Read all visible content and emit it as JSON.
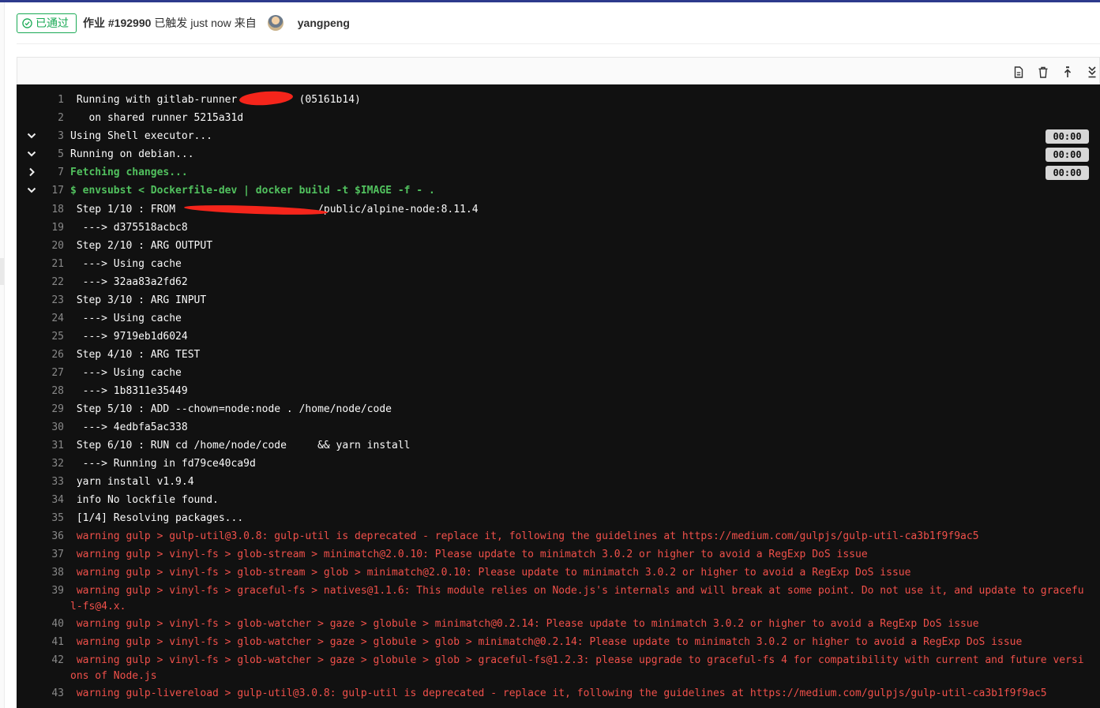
{
  "header": {
    "status_label": "已通过",
    "job_id": "作业 #192990",
    "triggered": "已触发",
    "time": "just now",
    "from": "来自",
    "user": "yangpeng"
  },
  "toolbar": {
    "icons": [
      "raw-log-icon",
      "erase-log-icon",
      "scroll-to-top-icon",
      "scroll-to-bottom-icon"
    ]
  },
  "log": {
    "lines": [
      {
        "num": "1",
        "text": " Running with gitlab-runner          (05161b14)",
        "color": "w"
      },
      {
        "num": "2",
        "text": "   on shared runner 5215a31d",
        "color": "w"
      },
      {
        "num": "3",
        "text": "Using Shell executor...",
        "color": "w",
        "toggle": "down",
        "duration": "00:00"
      },
      {
        "num": "5",
        "text": "Running on debian...",
        "color": "w",
        "toggle": "down",
        "duration": "00:00"
      },
      {
        "num": "7",
        "text": "Fetching changes...",
        "color": "g",
        "toggle": "right",
        "duration": "00:00"
      },
      {
        "num": "17",
        "text": "$ envsubst < Dockerfile-dev | docker build -t $IMAGE -f - .",
        "color": "g",
        "toggle": "down"
      },
      {
        "num": "18",
        "text": " Step 1/10 : FROM                       /public/alpine-node:8.11.4",
        "color": "w"
      },
      {
        "num": "19",
        "text": "  ---> d375518acbc8",
        "color": "w"
      },
      {
        "num": "20",
        "text": " Step 2/10 : ARG OUTPUT",
        "color": "w"
      },
      {
        "num": "21",
        "text": "  ---> Using cache",
        "color": "w"
      },
      {
        "num": "22",
        "text": "  ---> 32aa83a2fd62",
        "color": "w"
      },
      {
        "num": "23",
        "text": " Step 3/10 : ARG INPUT",
        "color": "w"
      },
      {
        "num": "24",
        "text": "  ---> Using cache",
        "color": "w"
      },
      {
        "num": "25",
        "text": "  ---> 9719eb1d6024",
        "color": "w"
      },
      {
        "num": "26",
        "text": " Step 4/10 : ARG TEST",
        "color": "w"
      },
      {
        "num": "27",
        "text": "  ---> Using cache",
        "color": "w"
      },
      {
        "num": "28",
        "text": "  ---> 1b8311e35449",
        "color": "w"
      },
      {
        "num": "29",
        "text": " Step 5/10 : ADD --chown=node:node . /home/node/code",
        "color": "w"
      },
      {
        "num": "30",
        "text": "  ---> 4edbfa5ac338",
        "color": "w"
      },
      {
        "num": "31",
        "text": " Step 6/10 : RUN cd /home/node/code     && yarn install",
        "color": "w"
      },
      {
        "num": "32",
        "text": "  ---> Running in fd79ce40ca9d",
        "color": "w"
      },
      {
        "num": "33",
        "text": " yarn install v1.9.4",
        "color": "w"
      },
      {
        "num": "34",
        "text": " info No lockfile found.",
        "color": "w"
      },
      {
        "num": "35",
        "text": " [1/4] Resolving packages...",
        "color": "w"
      },
      {
        "num": "36",
        "text": " warning gulp > gulp-util@3.0.8: gulp-util is deprecated - replace it, following the guidelines at https://medium.com/gulpjs/gulp-util-ca3b1f9f9ac5",
        "color": "r"
      },
      {
        "num": "37",
        "text": " warning gulp > vinyl-fs > glob-stream > minimatch@2.0.10: Please update to minimatch 3.0.2 or higher to avoid a RegExp DoS issue",
        "color": "r"
      },
      {
        "num": "38",
        "text": " warning gulp > vinyl-fs > glob-stream > glob > minimatch@2.0.10: Please update to minimatch 3.0.2 or higher to avoid a RegExp DoS issue",
        "color": "r"
      },
      {
        "num": "39",
        "text": " warning gulp > vinyl-fs > graceful-fs > natives@1.1.6: This module relies on Node.js's internals and will break at some point. Do not use it, and update to graceful-fs@4.x.",
        "color": "r"
      },
      {
        "num": "40",
        "text": " warning gulp > vinyl-fs > glob-watcher > gaze > globule > minimatch@0.2.14: Please update to minimatch 3.0.2 or higher to avoid a RegExp DoS issue",
        "color": "r"
      },
      {
        "num": "41",
        "text": " warning gulp > vinyl-fs > glob-watcher > gaze > globule > glob > minimatch@0.2.14: Please update to minimatch 3.0.2 or higher to avoid a RegExp DoS issue",
        "color": "r"
      },
      {
        "num": "42",
        "text": " warning gulp > vinyl-fs > glob-watcher > gaze > globule > glob > graceful-fs@1.2.3: please upgrade to graceful-fs 4 for compatibility with current and future versions of Node.js",
        "color": "r"
      },
      {
        "num": "43",
        "text": " warning gulp-livereload > gulp-util@3.0.8: gulp-util is deprecated - replace it, following the guidelines at https://medium.com/gulpjs/gulp-util-ca3b1f9f9ac5",
        "color": "r"
      }
    ]
  }
}
